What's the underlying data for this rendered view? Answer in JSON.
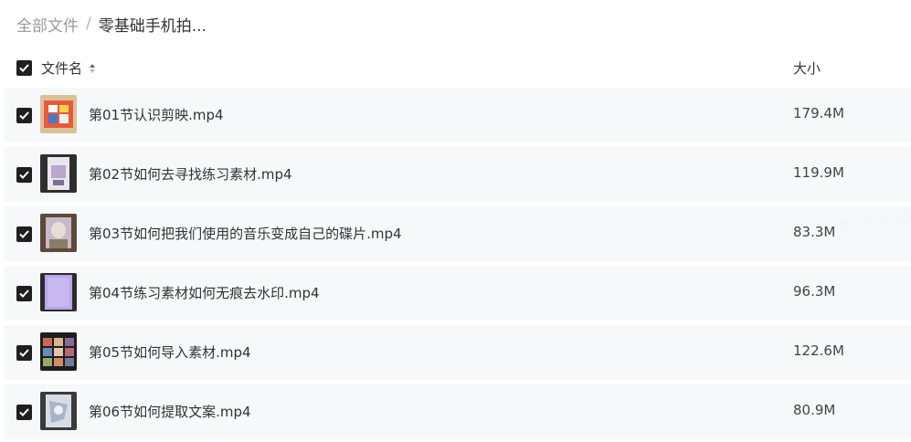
{
  "breadcrumb": {
    "root": "全部文件",
    "separator": "/",
    "current": "零基础手机拍..."
  },
  "header": {
    "name_label": "文件名",
    "size_label": "大小",
    "select_all_checked": true
  },
  "files": [
    {
      "name": "第01节认识剪映.mp4",
      "size": "179.4M",
      "checked": true
    },
    {
      "name": "第02节如何去寻找练习素材.mp4",
      "size": "119.9M",
      "checked": true
    },
    {
      "name": "第03节如何把我们使用的音乐变成自己的碟片.mp4",
      "size": "83.3M",
      "checked": true
    },
    {
      "name": "第04节练习素材如何无痕去水印.mp4",
      "size": "96.3M",
      "checked": true
    },
    {
      "name": "第05节如何导入素材.mp4",
      "size": "122.6M",
      "checked": true
    },
    {
      "name": "第06节如何提取文案.mp4",
      "size": "80.9M",
      "checked": true
    }
  ],
  "watermark": "xyax.cn",
  "colors": {
    "row_background": "#f7f8fa",
    "checkbox_fill": "#1f1f1f",
    "muted_text": "#9a9a9a"
  }
}
